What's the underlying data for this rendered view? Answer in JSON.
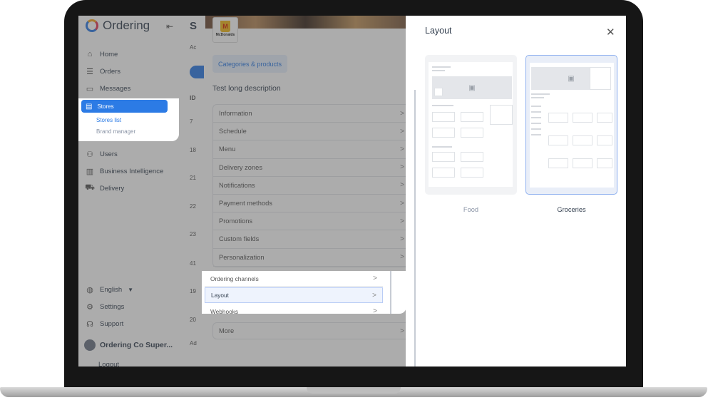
{
  "sidebar": {
    "app_name": "Ordering",
    "collapse_icon": "collapse-icon",
    "nav": [
      {
        "label": "Home",
        "icon": "home-icon"
      },
      {
        "label": "Orders",
        "icon": "list-icon"
      },
      {
        "label": "Messages",
        "icon": "chat-icon"
      }
    ],
    "stores": {
      "label": "Stores",
      "icon": "store-icon",
      "subitems": [
        "Stores list",
        "Brand manager"
      ]
    },
    "nav2": [
      {
        "label": "Users",
        "icon": "users-icon"
      },
      {
        "label": "Business Intelligence",
        "icon": "chart-icon"
      },
      {
        "label": "Delivery",
        "icon": "truck-icon"
      }
    ],
    "footer": [
      {
        "label": "English",
        "icon": "globe-icon"
      },
      {
        "label": "Settings",
        "icon": "gear-icon"
      },
      {
        "label": "Support",
        "icon": "headset-icon"
      }
    ],
    "user_name": "Ordering Co Super...",
    "logout": "Logout"
  },
  "stores_page": {
    "title_initial": "S",
    "tab_initial": "Ac",
    "id_header": "ID",
    "ids": [
      "7",
      "18",
      "21",
      "22",
      "23",
      "41",
      "19",
      "20"
    ],
    "footer_initial": "Ad"
  },
  "store_panel": {
    "brand_name": "McDonalds",
    "categories_button": "Categories & products",
    "description": "Test long description",
    "menu_items": [
      "Information",
      "Schedule",
      "Menu",
      "Delivery zones",
      "Notifications",
      "Payment methods",
      "Promotions",
      "Custom fields",
      "Personalization"
    ],
    "highlighted_items": [
      "Ordering channels",
      "Layout",
      "Webhooks"
    ],
    "active_item": "Layout",
    "more": "More"
  },
  "drawer": {
    "title": "Layout",
    "close_icon": "close-icon",
    "options": [
      {
        "label": "Food",
        "selected": false
      },
      {
        "label": "Groceries",
        "selected": true
      }
    ]
  },
  "colors": {
    "primary": "#2c7be5",
    "text": "#344050",
    "muted": "#8a94a6"
  }
}
